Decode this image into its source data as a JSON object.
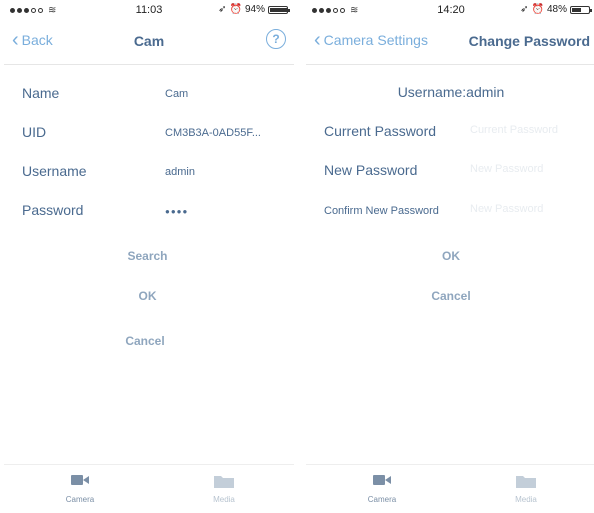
{
  "left": {
    "status": {
      "time": "11:03",
      "battery": "94%"
    },
    "nav": {
      "back": "Back",
      "title": "Cam",
      "help": "?"
    },
    "fields": [
      {
        "label": "Name",
        "value": "Cam"
      },
      {
        "label": "UID",
        "value": "CM3B3A-0AD55F..."
      },
      {
        "label": "Username",
        "value": "admin"
      },
      {
        "label": "Password",
        "value": "●●●●"
      }
    ],
    "buttons": {
      "search": "Search",
      "ok": "OK",
      "cancel": "Cancel"
    },
    "tabs": {
      "camera": "Camera",
      "media": "Media"
    }
  },
  "right": {
    "status": {
      "time": "14:20",
      "battery": "48%"
    },
    "nav": {
      "back": "Camera Settings",
      "title": "Change Password"
    },
    "username_label": "Username:",
    "username_value": "admin",
    "fields": [
      {
        "label": "Current Password",
        "placeholder": "Current Password"
      },
      {
        "label": "New Password",
        "placeholder": "New Password"
      },
      {
        "label": "Confirm New Password",
        "placeholder": "New Password"
      }
    ],
    "buttons": {
      "ok": "OK",
      "cancel": "Cancel"
    },
    "tabs": {
      "camera": "Camera",
      "media": "Media"
    }
  },
  "colors": {
    "accent": "#7aaedc",
    "text": "#4a6a8f",
    "button": "#8fa6be"
  },
  "icons": {
    "back": "chevron-left-icon",
    "help": "help-circle-icon",
    "camera": "video-camera-icon",
    "media": "folder-icon"
  }
}
